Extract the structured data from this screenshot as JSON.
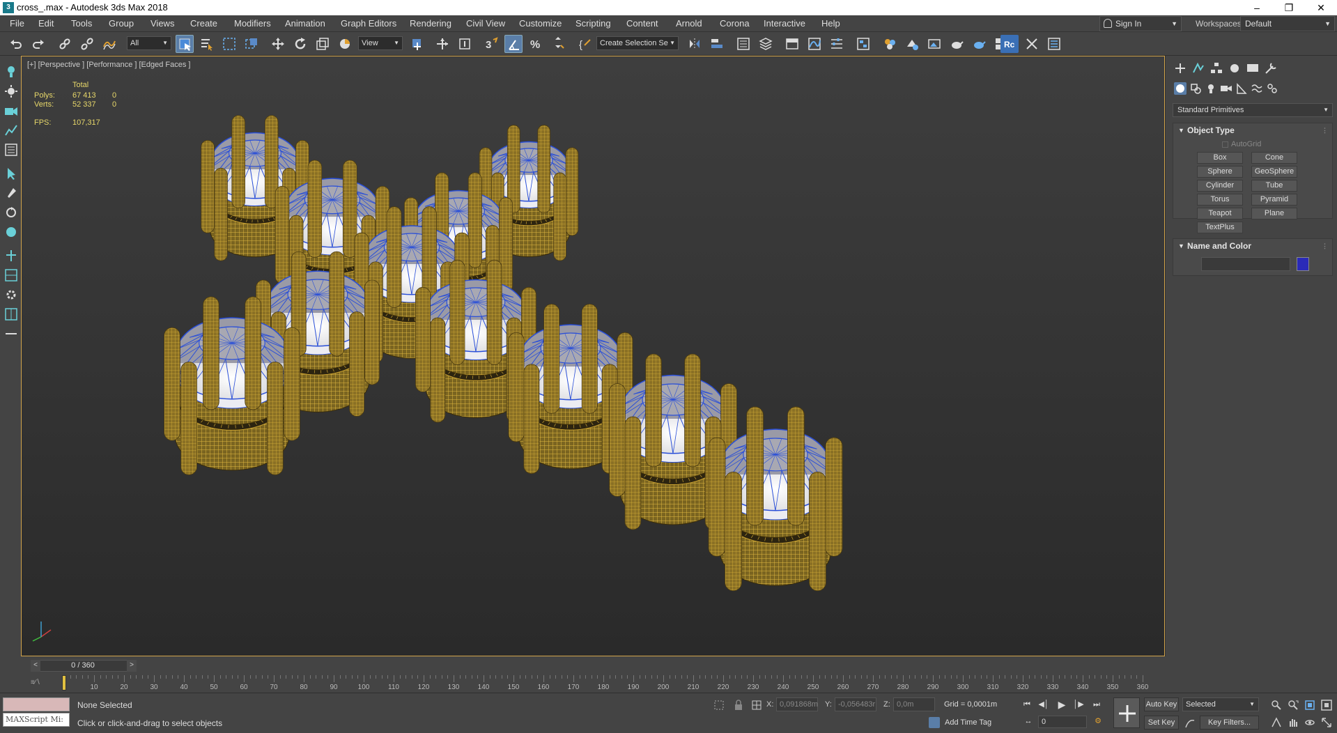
{
  "window": {
    "title": "cross_.max - Autodesk 3ds Max 2018"
  },
  "menu": [
    "File",
    "Edit",
    "Tools",
    "Group",
    "Views",
    "Create",
    "Modifiers",
    "Animation",
    "Graph Editors",
    "Rendering",
    "Civil View",
    "Customize",
    "Scripting",
    "Content",
    "Arnold",
    "Corona",
    "Interactive",
    "Help"
  ],
  "account": {
    "sign_in": "Sign In",
    "workspaces_label": "Workspaces:",
    "workspace": "Default"
  },
  "toolbar": {
    "selection_filter": "All",
    "ref_coord": "View",
    "named_selection": "Create Selection Se"
  },
  "viewport": {
    "label": "[+] [Perspective ] [Performance ] [Edged Faces ]",
    "stats": {
      "total_label": "Total",
      "polys_label": "Polys:",
      "polys_total": "67 413",
      "polys_sel": "0",
      "verts_label": "Verts:",
      "verts_total": "52 337",
      "verts_sel": "0",
      "fps_label": "FPS:",
      "fps": "107,317"
    }
  },
  "command_panel": {
    "category": "Standard Primitives",
    "object_type": {
      "title": "Object Type",
      "autogrid": "AutoGrid",
      "buttons": [
        "Box",
        "Cone",
        "Sphere",
        "GeoSphere",
        "Cylinder",
        "Tube",
        "Torus",
        "Pyramid",
        "Teapot",
        "Plane",
        "TextPlus"
      ]
    },
    "name_and_color": {
      "title": "Name and Color",
      "object_color": "#2a2ab8"
    }
  },
  "timeline": {
    "frame_display": "0 / 360",
    "prev": "<",
    "next": ">",
    "ticks": [
      0,
      10,
      20,
      30,
      40,
      50,
      60,
      70,
      80,
      90,
      100,
      110,
      120,
      130,
      140,
      150,
      160,
      170,
      180,
      190,
      200,
      210,
      220,
      230,
      240,
      250,
      260,
      270,
      280,
      290,
      300,
      310,
      320,
      330,
      340,
      350,
      360
    ]
  },
  "status": {
    "maxscript": "MAXScript Mi:",
    "selection": "None Selected",
    "prompt": "Click or click-and-drag to select objects",
    "x_label": "X:",
    "x_value": "0,091868m",
    "y_label": "Y:",
    "y_value": "-0,056483r",
    "z_label": "Z:",
    "z_value": "0,0m",
    "grid": "Grid = 0,0001m",
    "add_time_tag": "Add Time Tag",
    "frame": "0",
    "auto_key": "Auto Key",
    "set_key": "Set Key",
    "key_mode": "Selected",
    "key_filters": "Key Filters..."
  },
  "colors": {
    "gold_wire": "#c8a030",
    "gem_edge": "#2a4fd8",
    "viewport_border": "#d2a44a",
    "accent": "#5a7ea8"
  }
}
